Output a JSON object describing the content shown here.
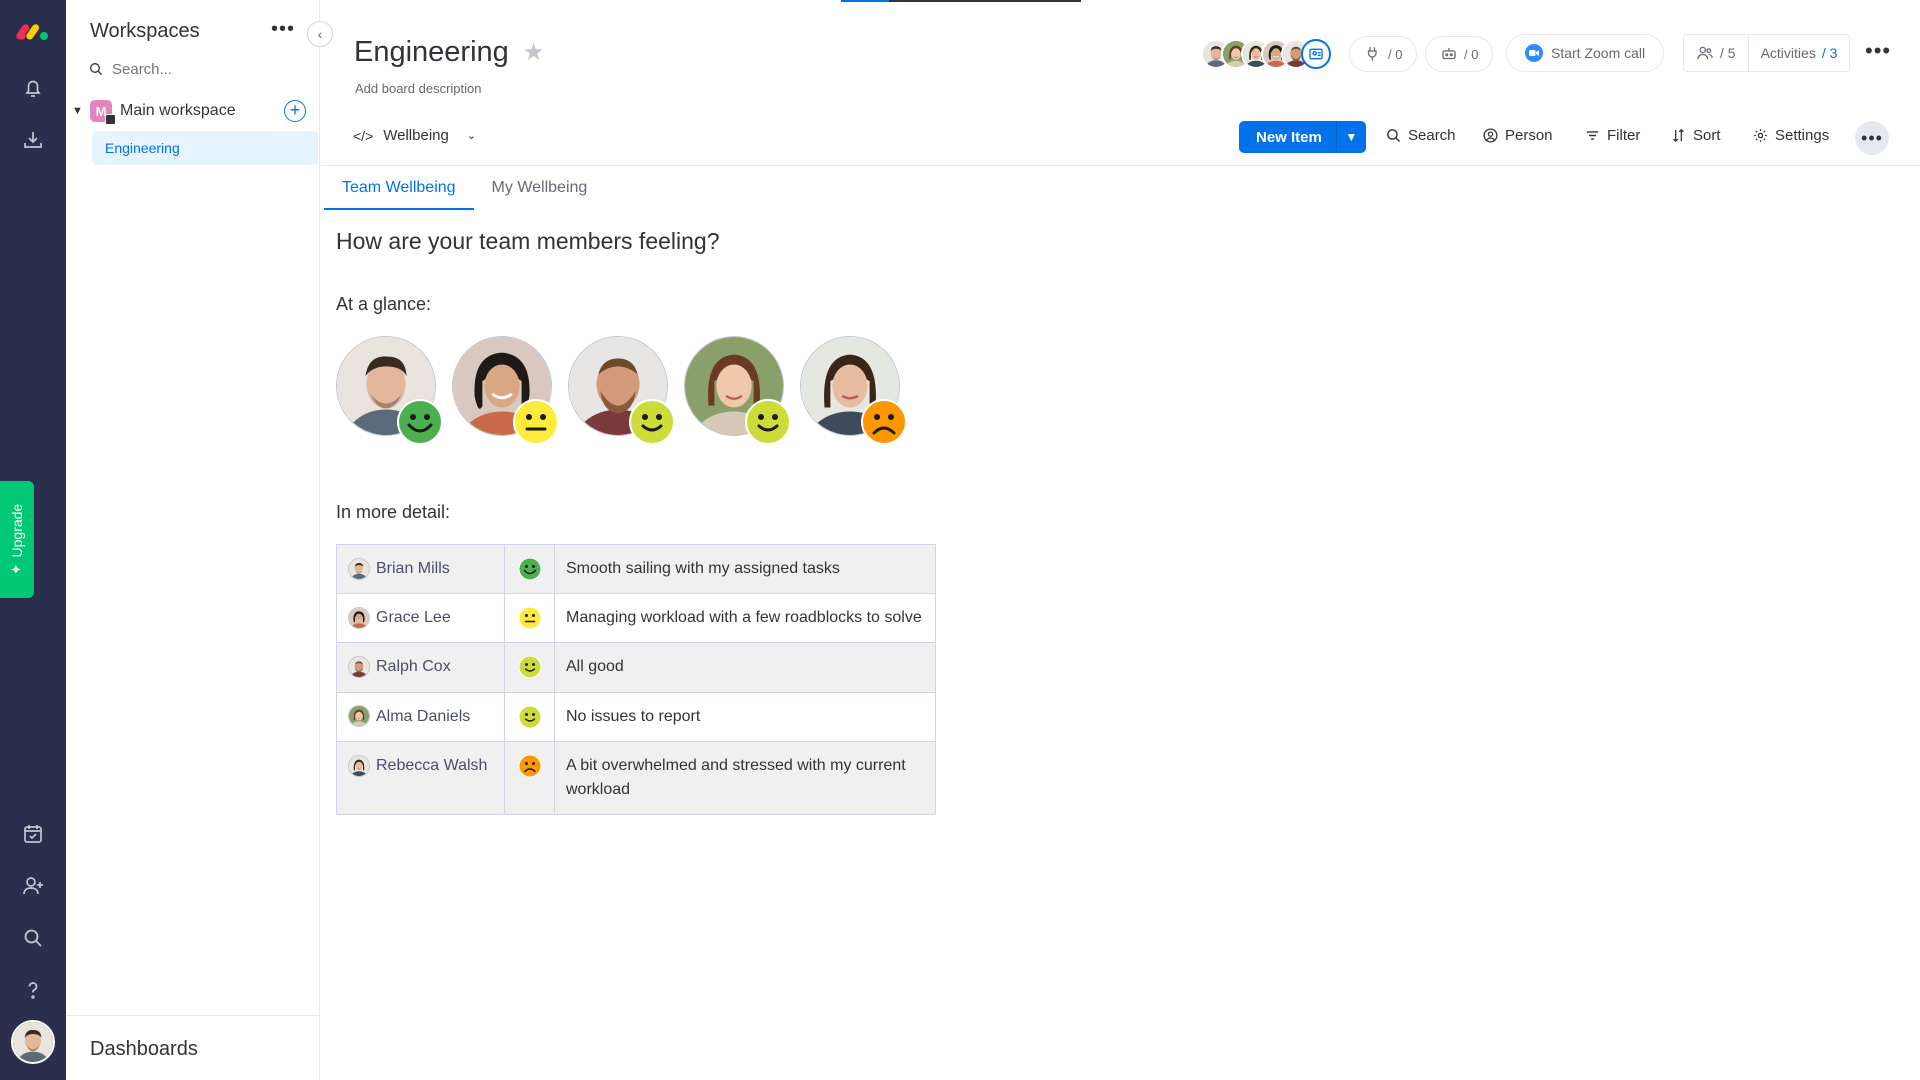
{
  "sidebar_rail": {
    "upgrade_label": "Upgrade"
  },
  "workspaces": {
    "title": "Workspaces",
    "search_placeholder": "Search...",
    "main_workspace": {
      "initial": "M",
      "name": "Main workspace"
    },
    "boards": [
      {
        "label": "Engineering"
      }
    ],
    "footer_label": "Dashboards"
  },
  "board": {
    "title": "Engineering",
    "description": "Add board description",
    "integrations_count": "/ 0",
    "automations_count": "/ 0",
    "zoom_label": "Start Zoom call",
    "members_count": "/ 5",
    "activities_label": "Activities",
    "activities_count": "/ 3",
    "view_label": "Wellbeing",
    "new_item_label": "New Item",
    "toolbar": {
      "search": "Search",
      "person": "Person",
      "filter": "Filter",
      "sort": "Sort",
      "settings": "Settings"
    },
    "tabs": [
      {
        "label": "Team Wellbeing",
        "active": true
      },
      {
        "label": "My Wellbeing",
        "active": false
      }
    ]
  },
  "wellbeing": {
    "heading": "How are your team members feeling?",
    "glance_label": "At a glance:",
    "detail_label": "In more detail:",
    "mood_colors": {
      "happy": "#4caf50",
      "neutral": "#ffeb3b",
      "content": "#cddc39",
      "sad": "#ff9800"
    },
    "members": [
      {
        "name": "Brian Mills",
        "mood": "happy",
        "message": "Smooth sailing with my assigned tasks"
      },
      {
        "name": "Grace Lee",
        "mood": "neutral",
        "message": "Managing workload with a few roadblocks to solve"
      },
      {
        "name": "Ralph Cox",
        "mood": "content",
        "message": "All good"
      },
      {
        "name": "Alma Daniels",
        "mood": "content",
        "message": "No issues to report"
      },
      {
        "name": "Rebecca Walsh",
        "mood": "sad",
        "message": "A bit overwhelmed and stressed with my current workload"
      }
    ]
  }
}
